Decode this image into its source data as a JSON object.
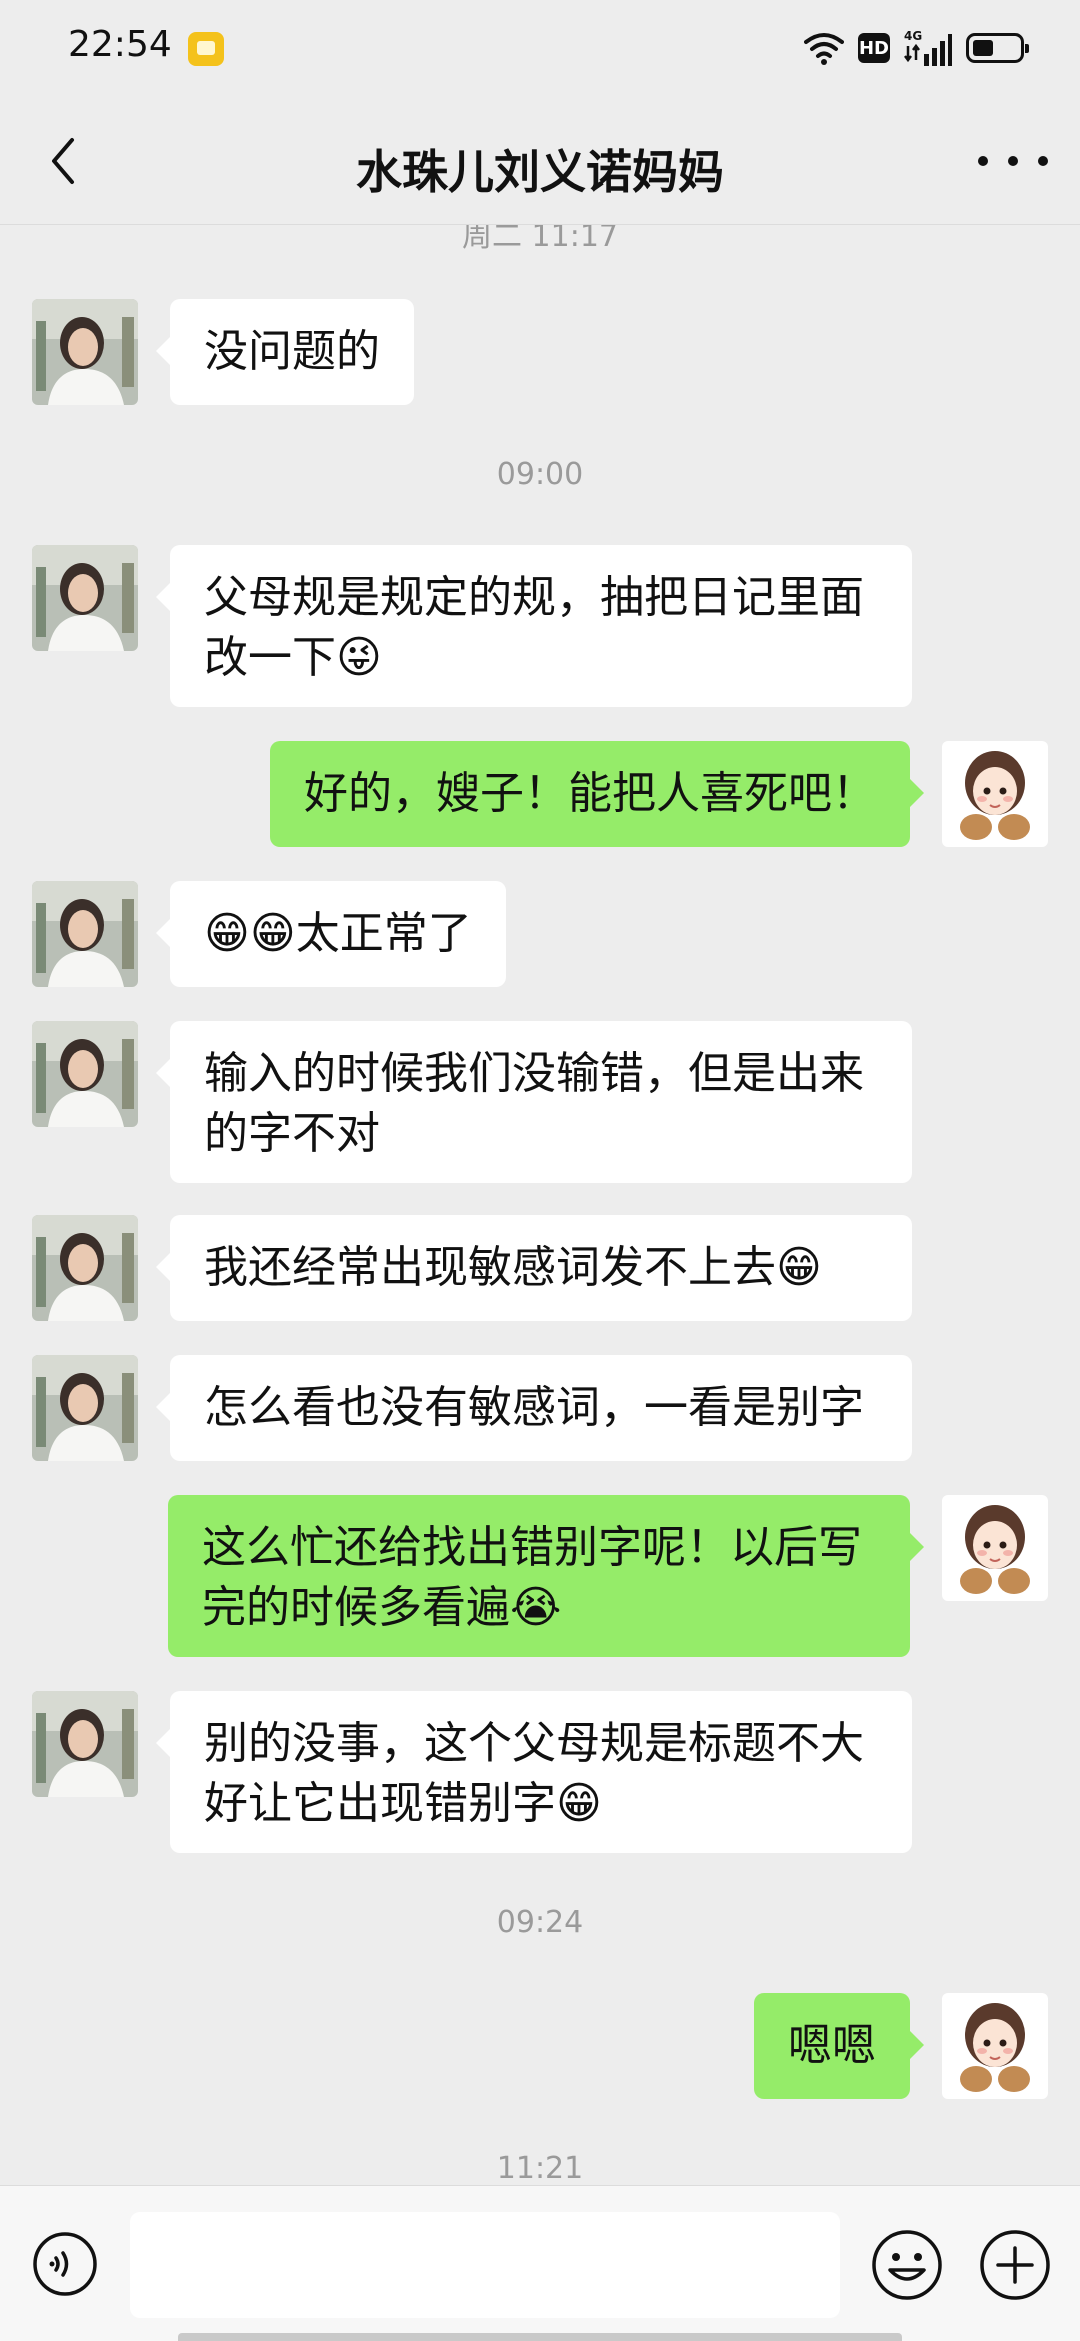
{
  "status_bar": {
    "time": "22:54",
    "hd_label": "HD",
    "network_label": "4G",
    "icons": [
      "notification-app-icon",
      "wifi-icon",
      "hd-icon",
      "signal-icon",
      "battery-icon"
    ]
  },
  "header": {
    "title": "水珠儿刘义诺妈妈",
    "back_icon": "chevron-left-icon",
    "more_icon": "more-icon"
  },
  "timestamps": {
    "t0": "周二 11:17",
    "t1": "09:00",
    "t2": "09:24",
    "t3": "11:21"
  },
  "messages": [
    {
      "from": "them",
      "text": "没问题的"
    },
    {
      "from": "them",
      "text": "父母规是规定的规，抽把日记里面改一下😜"
    },
    {
      "from": "me",
      "text": "好的，嫂子！能把人喜死吧！"
    },
    {
      "from": "them",
      "text": "😁😁太正常了"
    },
    {
      "from": "them",
      "text": "输入的时候我们没输错，但是出来的字不对"
    },
    {
      "from": "them",
      "text": "我还经常出现敏感词发不上去😁"
    },
    {
      "from": "them",
      "text": "怎么看也没有敏感词，一看是别字"
    },
    {
      "from": "me",
      "text": "这么忙还给找出错别字呢！以后写完的时候多看遍😭"
    },
    {
      "from": "them",
      "text": "别的没事，这个父母规是标题不大好让它出现错别字😁"
    },
    {
      "from": "me",
      "text": "嗯嗯"
    }
  ],
  "input_bar": {
    "value": "",
    "voice_icon": "voice-icon",
    "emoji_icon": "emoji-icon",
    "plus_icon": "plus-icon"
  },
  "colors": {
    "background": "#ededed",
    "incoming_bubble": "#ffffff",
    "outgoing_bubble": "#95ec69",
    "timestamp": "#9a9a9a"
  }
}
